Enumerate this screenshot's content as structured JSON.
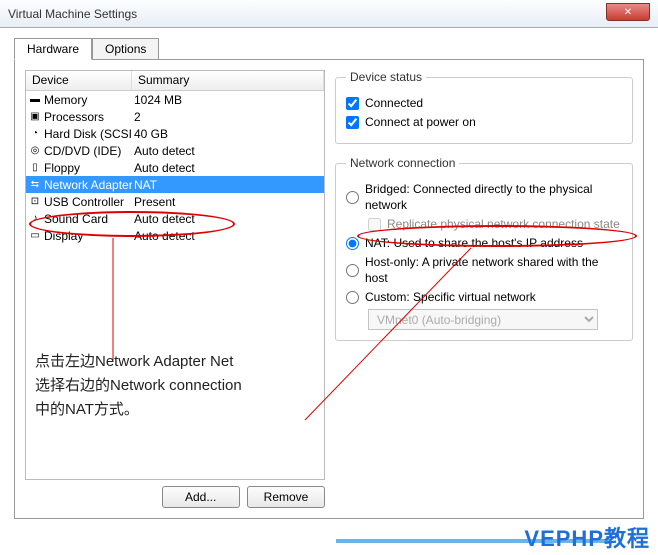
{
  "window": {
    "title": "Virtual Machine Settings"
  },
  "tabs": {
    "hardware": "Hardware",
    "options": "Options"
  },
  "list": {
    "headers": {
      "device": "Device",
      "summary": "Summary"
    },
    "rows": [
      {
        "icon": "▬",
        "device": "Memory",
        "summary": "1024 MB"
      },
      {
        "icon": "▣",
        "device": "Processors",
        "summary": "2"
      },
      {
        "icon": "◔",
        "device": "Hard Disk (SCSI)",
        "summary": "40 GB"
      },
      {
        "icon": "◎",
        "device": "CD/DVD (IDE)",
        "summary": "Auto detect"
      },
      {
        "icon": "▯",
        "device": "Floppy",
        "summary": "Auto detect"
      },
      {
        "icon": "⇆",
        "device": "Network Adapter",
        "summary": "NAT",
        "selected": true
      },
      {
        "icon": "⊡",
        "device": "USB Controller",
        "summary": "Present"
      },
      {
        "icon": "♪",
        "device": "Sound Card",
        "summary": "Auto detect"
      },
      {
        "icon": "▭",
        "device": "Display",
        "summary": "Auto detect"
      }
    ]
  },
  "buttons": {
    "add": "Add...",
    "remove": "Remove"
  },
  "status": {
    "legend": "Device status",
    "connected": "Connected",
    "connect_power": "Connect at power on"
  },
  "netconn": {
    "legend": "Network connection",
    "bridged": "Bridged: Connected directly to the physical network",
    "replicate": "Replicate physical network connection state",
    "nat": "NAT: Used to share the host's IP address",
    "hostonly": "Host-only: A private network shared with the host",
    "custom": "Custom: Specific virtual network",
    "vmnet": "VMnet0 (Auto-bridging)"
  },
  "annotation": {
    "line1": "点击左边Network Adapter Net",
    "line2": "选择右边的Network connection",
    "line3": "中的NAT方式。"
  },
  "watermark": "VEPHP教程"
}
